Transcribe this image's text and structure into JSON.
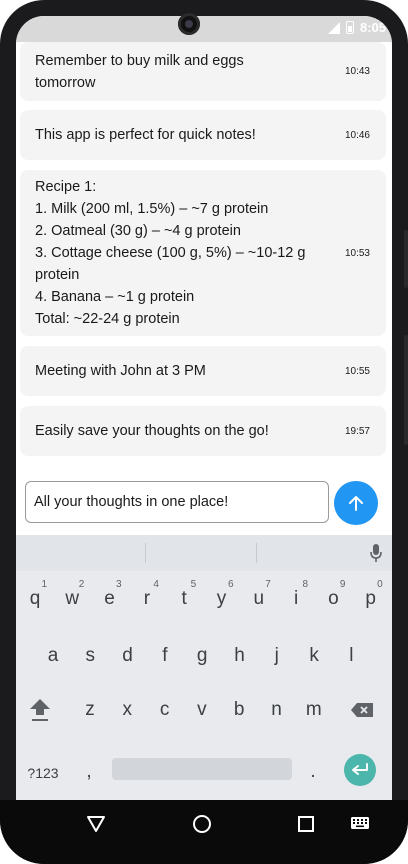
{
  "status_bar": {
    "time": "8:05"
  },
  "notes": [
    {
      "text": "Remember to buy milk and eggs\ntomorrow",
      "time": "10:43"
    },
    {
      "text": "This app is perfect for quick notes!",
      "time": "10:46"
    },
    {
      "text": "Recipe 1:\n1. Milk (200 ml, 1.5%) – ~7 g protein\n2. Oatmeal (30 g) – ~4 g protein\n3. Cottage cheese (100 g, 5%) – ~10-12 g\nprotein\n4. Banana – ~1 g protein\nTotal: ~22-24 g protein",
      "time": "10:53"
    },
    {
      "text": "Meeting with John at 3 PM",
      "time": "10:55"
    },
    {
      "text": "Easily save your thoughts on the go!",
      "time": "19:57"
    }
  ],
  "composer": {
    "value": "All your thoughts in one place!"
  },
  "keyboard": {
    "row1": [
      {
        "k": "q",
        "n": "1"
      },
      {
        "k": "w",
        "n": "2"
      },
      {
        "k": "e",
        "n": "3"
      },
      {
        "k": "r",
        "n": "4"
      },
      {
        "k": "t",
        "n": "5"
      },
      {
        "k": "y",
        "n": "6"
      },
      {
        "k": "u",
        "n": "7"
      },
      {
        "k": "i",
        "n": "8"
      },
      {
        "k": "o",
        "n": "9"
      },
      {
        "k": "p",
        "n": "0"
      }
    ],
    "row2": [
      "a",
      "s",
      "d",
      "f",
      "g",
      "h",
      "j",
      "k",
      "l"
    ],
    "row3": [
      "z",
      "x",
      "c",
      "v",
      "b",
      "n",
      "m"
    ],
    "symbols_label": "?123",
    "comma": ",",
    "period": "."
  },
  "colors": {
    "accent": "#2196f3",
    "enter": "#4db6ac"
  }
}
